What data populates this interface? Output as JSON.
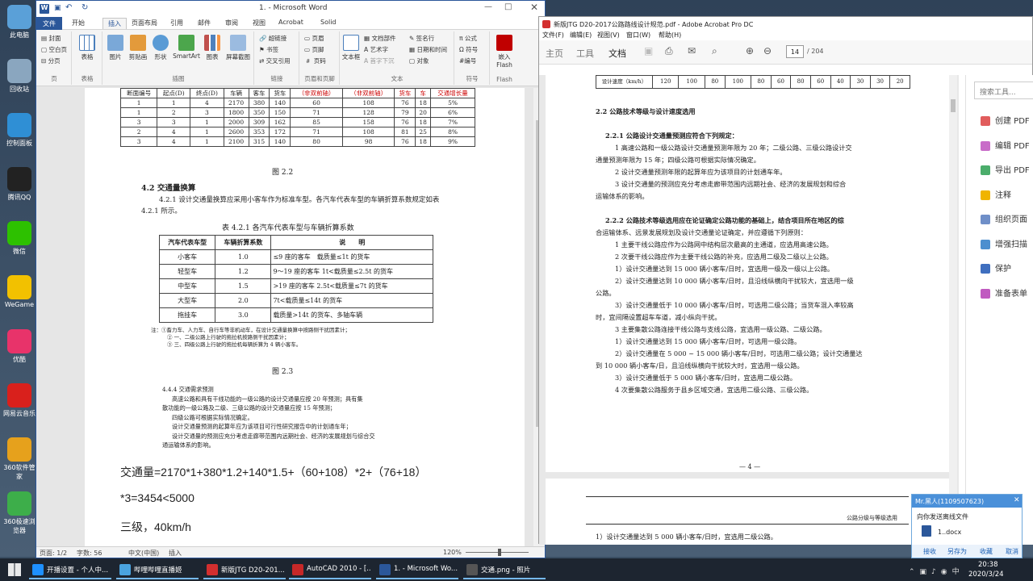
{
  "desktop_icons": [
    {
      "label": "此电脑",
      "color": "#5aa0d8"
    },
    {
      "label": "回收站",
      "color": "#8aa6bf"
    },
    {
      "label": "控制面板",
      "color": "#2f8fd5"
    },
    {
      "label": "腾讯QQ",
      "color": "#222222"
    },
    {
      "label": "微信",
      "color": "#2dc100"
    },
    {
      "label": "WeGame",
      "color": "#f2c100"
    },
    {
      "label": "优酷",
      "color": "#e8336a"
    },
    {
      "label": "网易云音乐",
      "color": "#d9201c"
    },
    {
      "label": "360软件管家",
      "color": "#e6a11c"
    },
    {
      "label": "360极速浏览器",
      "color": "#3dae4a"
    }
  ],
  "word": {
    "title": "1. - Microsoft Word",
    "tabs": [
      "文件",
      "开始",
      "插入",
      "页面布局",
      "引用",
      "邮件",
      "审阅",
      "视图",
      "Acrobat",
      "Solid"
    ],
    "ribbon": {
      "pages": [
        "封面",
        "空白页",
        "分页"
      ],
      "pages_label": "页",
      "table_btn": "表格",
      "table_label": "表格",
      "illus": [
        "图片",
        "剪贴画",
        "形状",
        "SmartArt",
        "图表",
        "屏幕截图"
      ],
      "illus_label": "插图",
      "links": [
        "超链接",
        "书签",
        "交叉引用"
      ],
      "links_label": "链接",
      "hf": [
        "页眉",
        "页脚",
        "页码"
      ],
      "hf_label": "页眉和页脚",
      "textbox": "文本框",
      "text_items": [
        "文档部件",
        "艺术字",
        "首字下沉",
        "签名行",
        "日期和时间",
        "对象"
      ],
      "text_label": "文本",
      "sym": [
        "公式",
        "符号",
        "编号"
      ],
      "sym_label": "符号",
      "flash": "嵌入Flash",
      "flash_label": "Flash"
    },
    "table1": {
      "header": [
        "断面编号",
        "起点(D)",
        "终点(D)",
        "车辆",
        "客车",
        "货车",
        "（非双前轴）",
        "（非双前轴）",
        "货车",
        "车",
        "交通增长量"
      ],
      "rows": [
        [
          "1",
          "1",
          "4",
          "2170",
          "380",
          "140",
          "60",
          "108",
          "76",
          "18",
          "5%"
        ],
        [
          "1",
          "2",
          "3",
          "1800",
          "350",
          "150",
          "71",
          "128",
          "79",
          "20",
          "6%"
        ],
        [
          "3",
          "3",
          "1",
          "2000",
          "309",
          "162",
          "85",
          "158",
          "76",
          "18",
          "7%"
        ],
        [
          "2",
          "4",
          "1",
          "2600",
          "353",
          "172",
          "71",
          "108",
          "81",
          "25",
          "8%"
        ],
        [
          "3",
          "4",
          "1",
          "2100",
          "315",
          "140",
          "80",
          "98",
          "76",
          "18",
          "9%"
        ]
      ]
    },
    "fig22": "图 2.2",
    "sec42": "4.2  交通量换算",
    "para421": "4.2.1  设计交通量换算应采用小客车作为标准车型。各汽车代表车型的车辆折算系数规定如表 4.2.1 所示。",
    "tbl421_title": "表 4.2.1  各汽车代表车型与车辆折算系数",
    "tbl421_head": [
      "汽车代表车型",
      "车辆折算系数",
      "说　　明"
    ],
    "tbl421_rows": [
      [
        "小客车",
        "1.0",
        "≤9 座的客车　载质量≤1t 的货车"
      ],
      [
        "轻型车",
        "1.2",
        "9～19 座的客车 1t<载质量≤2.5t 的货车"
      ],
      [
        "中型车",
        "1.5",
        ">19 座的客车  2.5t<载质量≤7t 的货车"
      ],
      [
        "大型车",
        "2.0",
        "7t<载质量≤14t 的货车"
      ],
      [
        "拖挂车",
        "3.0",
        "载质量>14t 的货车、多轴车辆"
      ]
    ],
    "tbl421_notes": [
      "注：①畜力车、人力车、自行车等非机动车，在设计交通量换算中按路侧干扰因素计；",
      "② 一、二级公路上行驶的拖拉机按路侧干扰因素计；",
      "③ 三、四级公路上行驶的拖拉机每辆折算为 4 辆小客车。"
    ],
    "fig23": "图 2.3",
    "sec444": [
      "4.4.4 交通需求预测",
      "高速公路和具有干线功能的一级公路的设计交通量应按 20 年预测；具有集",
      "散功能的一级公路及二级、三级公路的设计交通量应按 15 年预测；",
      "四级公路可根据实际情况确定。",
      "设计交通量预测的起算年应为该项目可行性研究报告中的计划通车年；",
      "设计交通量的预测应充分考虑走廊带范围内远期社会、经济的发展规划与综合交",
      "通运输体系的影响。"
    ],
    "calc1": "交通量=2170*1+380*1.2+140*1.5+（60+108）*2+（76+18）",
    "calc2": "*3=3454<5000",
    "calc3": "三级，40km/h",
    "status": {
      "page": "页面: 1/2",
      "words": "字数: 56",
      "lang": "中文(中国)",
      "mode": "插入",
      "zoom": "120%"
    }
  },
  "acrobat": {
    "title": "新版JTG D20-2017公路路线设计规范.pdf - Adobe Acrobat Pro DC",
    "menu": [
      "文件(F)",
      "编辑(E)",
      "视图(V)",
      "窗口(W)",
      "帮助(H)"
    ],
    "tabs": [
      "主页",
      "工具",
      "文档"
    ],
    "page_num": "14",
    "page_total": "/ 204",
    "speed_row": [
      "设计速度（km/h）",
      "120",
      "100",
      "80",
      "100",
      "80",
      "60",
      "80",
      "60",
      "40",
      "30",
      "30",
      "20"
    ],
    "lines": [
      "2.2   公路技术等级与设计速度选用",
      "2.2.1   公路设计交通量预测应符合下列规定：",
      "1   高速公路和一级公路设计交通量预测年限为 20 年；二级公路、三级公路设计交",
      "通量预测年限为 15 年；四级公路可根据实际情况确定。",
      "2   设计交通量预测年限的起算年应为该项目的计划通车年。",
      "3   设计交通量的预测应充分考虑走廊带范围内远期社会、经济的发展规划和综合",
      "运输体系的影响。",
      "2.2.2   公路技术等级选用应在论证确定公路功能的基础上，结合项目所在地区的综",
      "合运输体系、远景发展规划及设计交通量论证确定，并应遵循下列原则：",
      "1   主要干线公路应作为公路网中结构层次最高的主通道，应选用高速公路。",
      "2   次要干线公路应作为主要干线公路的补充，应选用二级及二级以上公路。",
      "1）设计交通量达到 15 000 辆小客车/日时，宜选用一级及一级以上公路。",
      "2）设计交通量达到 10 000 辆小客车/日时，且沿线纵横向干扰较大，宜选用一级",
      "公路。",
      "3）设计交通量低于 10 000 辆小客车/日时，可选用二级公路；当货车混入率较高",
      "时，宜间隔设置超车车道，减小纵向干扰。",
      "3   主要集散公路连接干线公路与支线公路，宜选用一级公路、二级公路。",
      "1）设计交通量达到 15 000 辆小客车/日时，可选用一级公路。",
      "2）设计交通量在 5 000 ~ 15 000 辆小客车/日时，可选用二级公路；设计交通量达",
      "到 10 000 辆小客车/日，且沿线纵横向干扰较大时，宜选用一级公路。",
      "3）设计交通量低于 5 000 辆小客车/日时，宜选用二级公路。",
      "4   次要集散公路服务于县乡区域交通，宜选用二级公路、三级公路。"
    ],
    "page_foot": "— 4 —",
    "page2_header": "公路分级与等级选用",
    "page2_line": "1）设计交通量达到 5 000 辆小客车/日时，宜选用二级公路。",
    "side_search": "搜索工具...",
    "side_tools": [
      {
        "label": "创建 PDF",
        "color": "#e15c5c"
      },
      {
        "label": "编辑 PDF",
        "color": "#c86cc8"
      },
      {
        "label": "导出 PDF",
        "color": "#4bad6b"
      },
      {
        "label": "注释",
        "color": "#f0b400"
      },
      {
        "label": "组织页面",
        "color": "#6f8fc8"
      },
      {
        "label": "增强扫描",
        "color": "#4c8fcf"
      },
      {
        "label": "保护",
        "color": "#3f6fbf"
      },
      {
        "label": "准备表单",
        "color": "#c05ac0"
      }
    ]
  },
  "chat": {
    "title": "Mr.黑人(1109507623)",
    "message": "向你发送离线文件",
    "file": "1..docx",
    "actions": [
      "接收",
      "另存为",
      "收藏",
      "取消"
    ]
  },
  "taskbar": {
    "items": [
      {
        "label": "开播设置 - 个人中...",
        "color": "#1e90ff"
      },
      {
        "label": "哔哩哔哩直播姬",
        "color": "#4aa3df"
      },
      {
        "label": "新版JTG D20-201...",
        "color": "#d32f2f"
      },
      {
        "label": "AutoCAD 2010 - [...",
        "color": "#c62828"
      },
      {
        "label": "1. - Microsoft Wo...",
        "color": "#2b579a"
      },
      {
        "label": "交通.png - 照片",
        "color": "#555555"
      }
    ],
    "time": "20:38",
    "date": "2020/3/24"
  }
}
